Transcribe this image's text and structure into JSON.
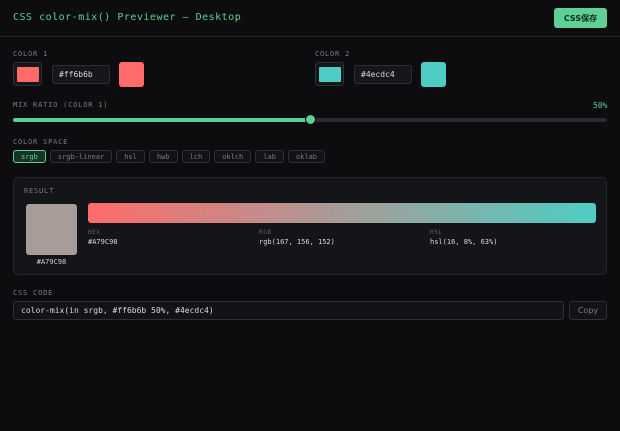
{
  "header": {
    "title": "CSS color-mix() Previewer — Desktop",
    "save_label": "CSS保存"
  },
  "color1": {
    "label": "COLOR 1",
    "value": "#ff6b6b",
    "color": "#ff6b6b"
  },
  "color2": {
    "label": "COLOR 2",
    "value": "#4ecdc4",
    "color": "#4ecdc4"
  },
  "ratio": {
    "label": "MIX RATIO (COLOR 1)",
    "value_text": "50%",
    "value": 50
  },
  "colorspace": {
    "label": "COLOR SPACE",
    "options": [
      "srgb",
      "srgb-linear",
      "hsl",
      "hwb",
      "lch",
      "oklch",
      "lab",
      "oklab"
    ],
    "selected": "srgb"
  },
  "result": {
    "label": "RESULT",
    "color": "#a79c98",
    "hex_caption": "#A79C98",
    "hex_label": "HEX",
    "hex_value": "#A79C98",
    "rgb_label": "RGB",
    "rgb_value": "rgb(167, 156, 152)",
    "hsl_label": "HSL",
    "hsl_value": "hsl(16, 8%, 63%)"
  },
  "code": {
    "label": "CSS CODE",
    "value": "color-mix(in srgb, #ff6b6b 50%, #4ecdc4)",
    "copy_label": "Copy"
  },
  "colors": {
    "accent": "#5ecf95"
  }
}
